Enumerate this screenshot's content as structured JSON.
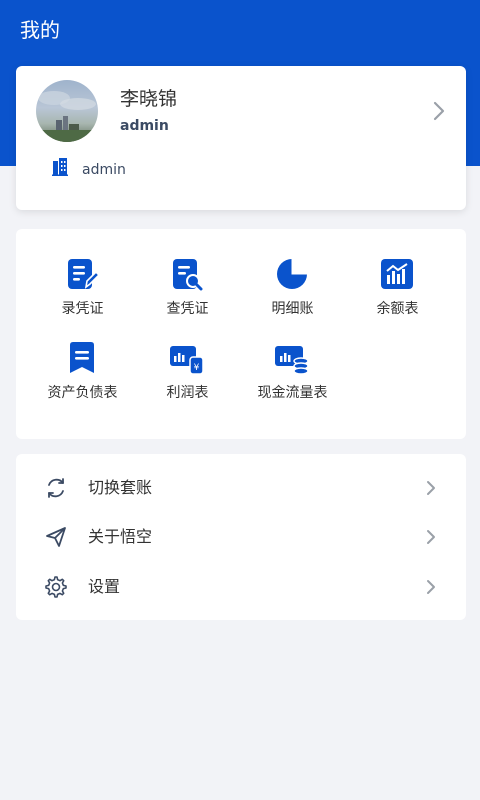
{
  "header": {
    "title": "我的"
  },
  "profile": {
    "name": "李晓锦",
    "account": "admin",
    "org": "admin"
  },
  "functions": [
    {
      "label": "录凭证",
      "icon": "edit-voucher-icon"
    },
    {
      "label": "查凭证",
      "icon": "search-voucher-icon"
    },
    {
      "label": "明细账",
      "icon": "pie-chart-icon"
    },
    {
      "label": "余额表",
      "icon": "bar-chart-icon"
    },
    {
      "label": "资产负债表",
      "icon": "balance-sheet-icon"
    },
    {
      "label": "利润表",
      "icon": "profit-icon"
    },
    {
      "label": "现金流量表",
      "icon": "cash-flow-icon"
    }
  ],
  "menu": [
    {
      "label": "切换套账",
      "icon": "refresh-icon"
    },
    {
      "label": "关于悟空",
      "icon": "send-icon"
    },
    {
      "label": "设置",
      "icon": "gear-icon"
    }
  ],
  "colors": {
    "primary": "#0a53cc",
    "background": "#f2f3f7"
  }
}
